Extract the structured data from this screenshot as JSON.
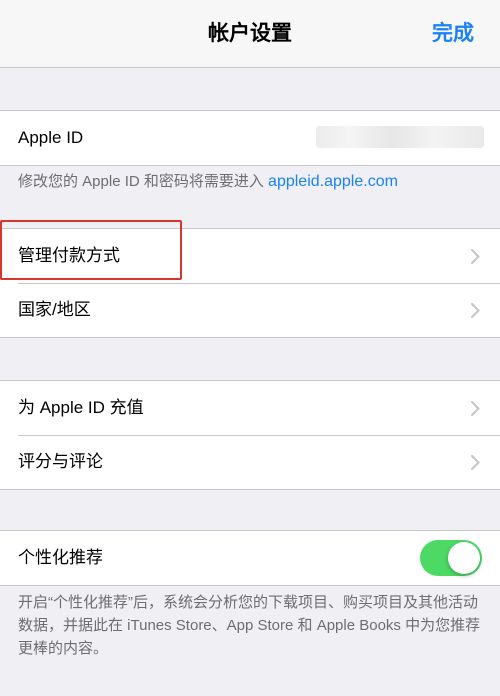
{
  "navbar": {
    "title": "帐户设置",
    "done_label": "完成"
  },
  "apple_id": {
    "label": "Apple ID",
    "footer_text": "修改您的 Apple ID 和密码将需要进入 ",
    "footer_link": "appleid.apple.com"
  },
  "payment_group": {
    "items": [
      {
        "label": "管理付款方式"
      },
      {
        "label": "国家/地区"
      }
    ]
  },
  "account_group": {
    "items": [
      {
        "label": "为 Apple ID 充值"
      },
      {
        "label": "评分与评论"
      }
    ]
  },
  "personalization": {
    "label": "个性化推荐",
    "toggle_on": true,
    "footer_text": "开启“个性化推荐”后，系统会分析您的下载项目、购买项目及其他活动数据，并据此在 iTunes Store、App Store 和 Apple Books 中为您推荐更棒的内容。"
  },
  "colors": {
    "accent": "#1a82f6",
    "toggle_on": "#4cd964",
    "highlight": "#d9352a",
    "background": "#efeff4"
  }
}
